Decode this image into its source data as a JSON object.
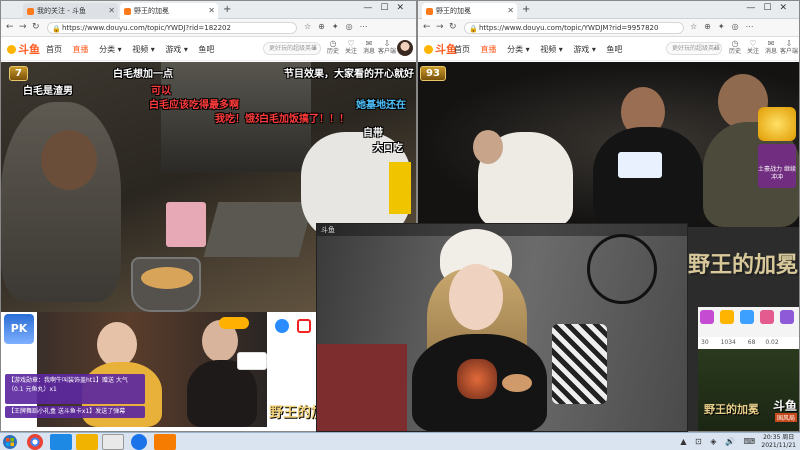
{
  "left_window": {
    "tabs": [
      {
        "label": "我的关注 - 斗鱼",
        "active": false
      },
      {
        "label": "野王的加冕",
        "active": true
      }
    ],
    "url": "https://www.douyu.com/topic/YWDJ?rid=182202",
    "logo": "斗鱼",
    "nav": [
      "首页",
      "直播",
      "分类 ▾",
      "视频 ▾",
      "游戏 ▾",
      "鱼吧"
    ],
    "nav_active_index": 1,
    "search_placeholder": "更好玩的超级英雄",
    "user_icons": [
      "历史",
      "关注",
      "消息",
      "客户端"
    ],
    "badge": "7",
    "danmaku": [
      {
        "text": "白毛想加一点",
        "color": "#ffffff"
      },
      {
        "text": "节目效果，大家看的开心就好",
        "color": "#ffffff"
      },
      {
        "text": "白毛是渣男",
        "color": "#ffffff"
      },
      {
        "text": "可以",
        "color": "#ff3b3b"
      },
      {
        "text": "白毛应该吃得最多啊",
        "color": "#ff3b3b"
      },
      {
        "text": "她基地还在",
        "color": "#4fc3ff"
      },
      {
        "text": "我吃！饿死我了",
        "color": "#ff3b3b"
      },
      {
        "text": "白毛加饭搞了！！！",
        "color": "#ff3b3b"
      },
      {
        "text": "自带",
        "color": "#ffffff"
      },
      {
        "text": "大口吃",
        "color": "#ffffff"
      }
    ],
    "chat_lines": [
      "【游戏勋章：我啊牛叫装饰盖ht1】赠送 大气（0.1 元鱼丸）x1",
      "【王牌舞蹈小礼盒 送斗鱼卡x1】发送了弹幕"
    ],
    "watermark": "野王的加冕",
    "pk_badge": "PK"
  },
  "right_window": {
    "tabs": [
      {
        "label": "野王的加冕",
        "active": true
      }
    ],
    "url": "https://www.douyu.com/topic/YWDJM?rid=9957820",
    "logo": "斗鱼",
    "nav": [
      "首页",
      "直播",
      "分类 ▾",
      "视频 ▾",
      "游戏 ▾",
      "鱼吧"
    ],
    "nav_active_index": 1,
    "search_placeholder": "更好玩的超级英雄",
    "user_icons": [
      "历史",
      "关注",
      "消息",
      "客户端"
    ],
    "badge": "93",
    "corner_label": "土豪战力 继续冲冲",
    "overlay_tag": "斗鱼",
    "watermark": "野王的加冕",
    "bottom_logo": "斗鱼",
    "bottom_logo_sub": "国风局",
    "stats": [
      "30",
      "1034",
      "68",
      "0.02"
    ]
  },
  "taskbar": {
    "apps": [
      "chrome",
      "ie",
      "media-player",
      "explorer",
      "edge",
      "app"
    ],
    "clock_time": "20:35 周日",
    "clock_date": "2021/11/21"
  }
}
